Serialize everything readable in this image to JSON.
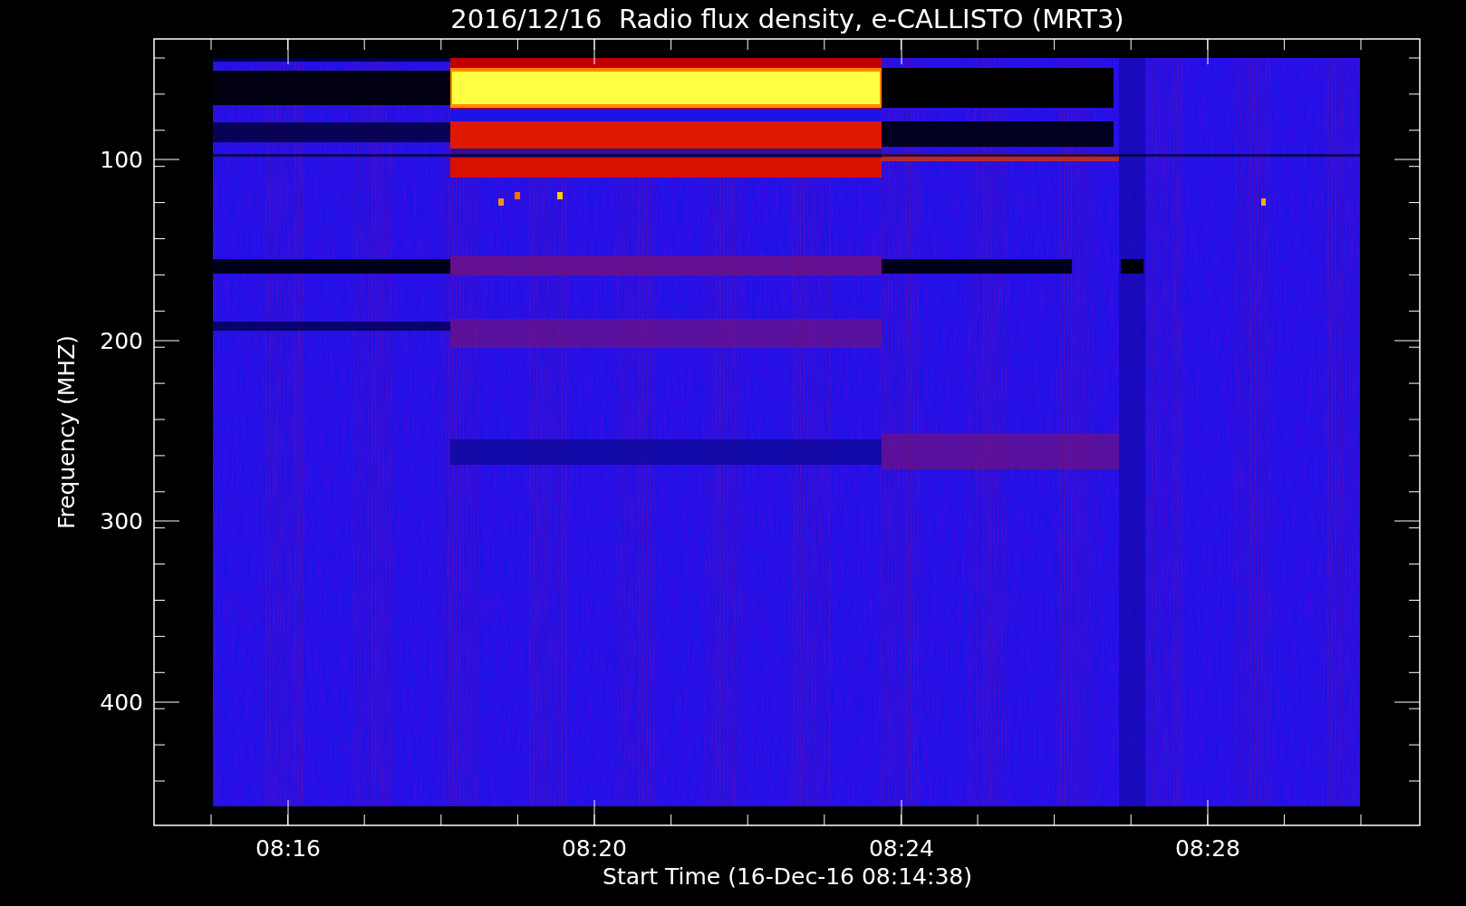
{
  "title": "2016/12/16  Radio flux density, e-CALLISTO (MRT3)",
  "ylabel": "Frequency (MHZ)",
  "xlabel": "Start Time (16-Dec-16 08:14:38)",
  "yticks": [
    "100",
    "200",
    "300",
    "400"
  ],
  "xticks": [
    "08:16",
    "08:20",
    "08:24",
    "08:28"
  ]
}
